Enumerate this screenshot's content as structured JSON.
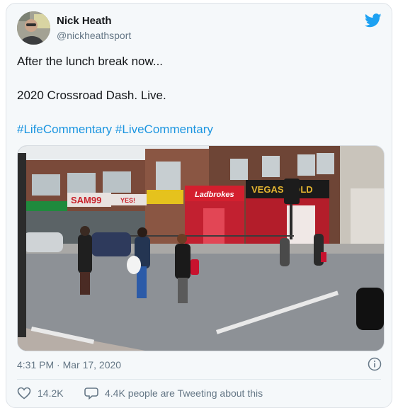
{
  "tweet": {
    "author_name": "Nick Heath",
    "author_handle": "@nickheathsport",
    "line1": "After the lunch break now...",
    "line2": "2020 Crossroad Dash. Live.",
    "hashtags": [
      "#LifeCommentary",
      "#LiveCommentary"
    ],
    "timestamp": "4:31 PM · Mar 17, 2020",
    "like_count": "14.2K",
    "tweeting_text": "4.4K people are Tweeting about this"
  },
  "media": {
    "signs": [
      "SAM99",
      "YES!",
      "Ladbrokes",
      "VEGAS GOLD"
    ]
  },
  "icons": {
    "brand": "twitter-bird-icon",
    "info": "info-icon",
    "like": "heart-icon",
    "reply": "speech-bubble-icon"
  },
  "colors": {
    "link": "#1b95e0",
    "brand": "#1da1f2",
    "secondary_text": "#657786",
    "card_background": "#f5f8fa"
  }
}
